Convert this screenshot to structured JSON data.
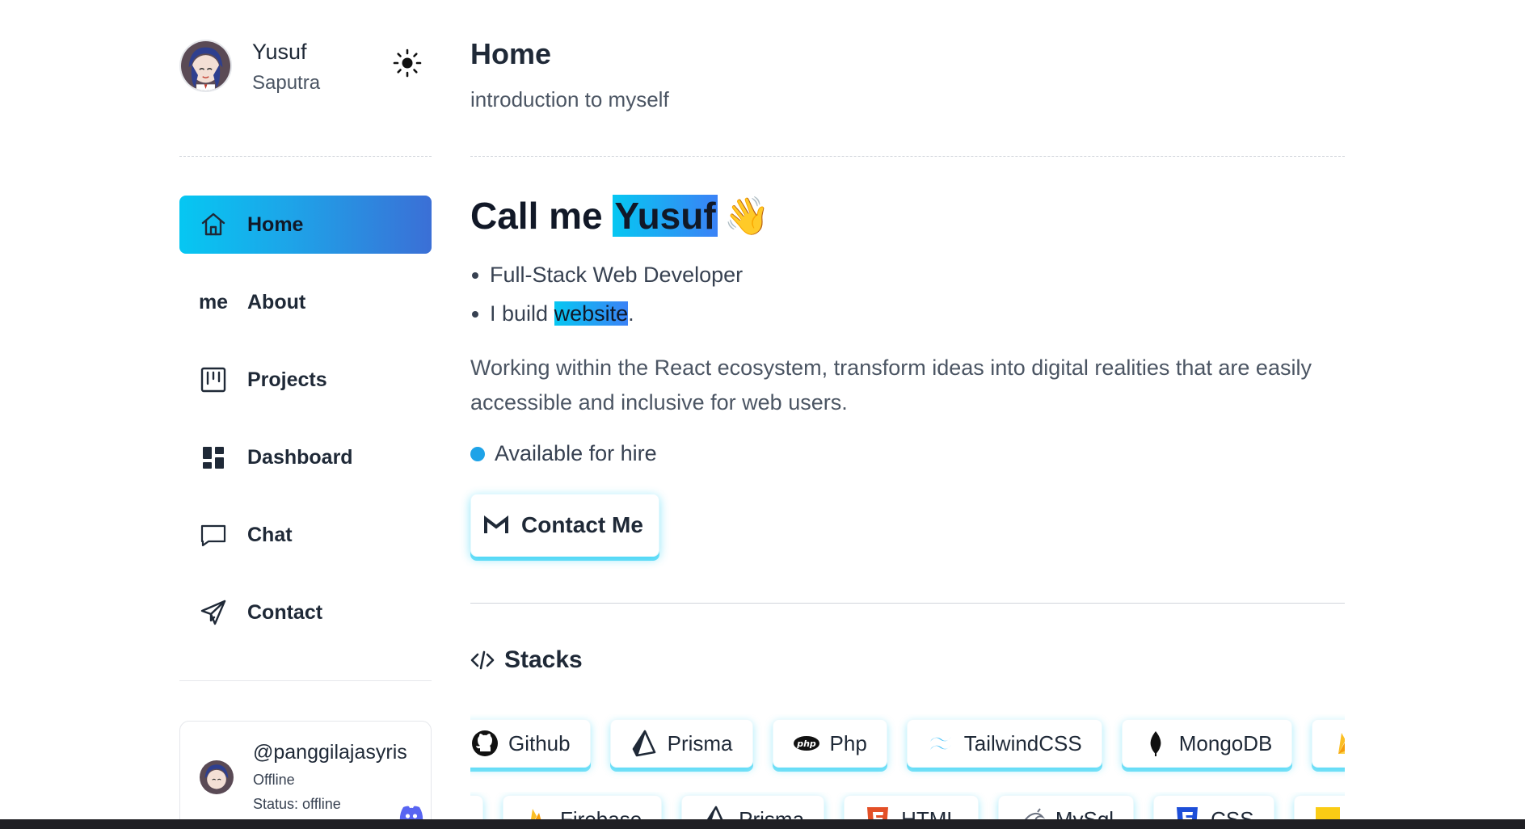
{
  "profile": {
    "first_name": "Yusuf",
    "last_name": "Saputra"
  },
  "header": {
    "title": "Home",
    "subtitle": "introduction to myself"
  },
  "sidebar": {
    "items": [
      {
        "label": "Home",
        "icon": "home-icon",
        "active": true
      },
      {
        "label": "About",
        "icon": "me-text-icon",
        "icon_text": "me",
        "active": false
      },
      {
        "label": "Projects",
        "icon": "projects-board-icon",
        "active": false
      },
      {
        "label": "Dashboard",
        "icon": "dashboard-grid-icon",
        "active": false
      },
      {
        "label": "Chat",
        "icon": "chat-bubble-icon",
        "active": false
      },
      {
        "label": "Contact",
        "icon": "paper-plane-icon",
        "active": false
      }
    ]
  },
  "discord": {
    "username": "@panggilajasyris",
    "state": "Offline",
    "status": "Status: offline"
  },
  "hero": {
    "prefix": "Call me",
    "name": "Yusuf",
    "emoji": "👋",
    "bullet_1": "Full-Stack Web Developer",
    "bullet_2_prefix": "I build",
    "bullet_2_highlight": "website",
    "bullet_2_suffix": ".",
    "description": "Working within the React ecosystem, transform ideas into digital realities that are easily accessible and inclusive for web users.",
    "availability": "Available for hire"
  },
  "contact_button": {
    "label": "Contact Me",
    "icon": "gmail-icon"
  },
  "stacks": {
    "heading": "Stacks",
    "row1": [
      {
        "label": "Github",
        "icon": "github-icon"
      },
      {
        "label": "Prisma",
        "icon": "prisma-icon"
      },
      {
        "label": "Php",
        "icon": "php-icon"
      },
      {
        "label": "TailwindCSS",
        "icon": "tailwind-icon"
      },
      {
        "label": "MongoDB",
        "icon": "mongodb-icon"
      },
      {
        "label": "",
        "icon": "firebase-icon"
      }
    ],
    "row2": [
      {
        "label": "",
        "icon": "tag-icon"
      },
      {
        "label": "Firebase",
        "icon": "firebase-icon"
      },
      {
        "label": "Prisma",
        "icon": "prisma-icon"
      },
      {
        "label": "HTML",
        "icon": "html5-icon"
      },
      {
        "label": "MySql",
        "icon": "mysql-icon"
      },
      {
        "label": "CSS",
        "icon": "css3-icon"
      },
      {
        "label": "",
        "icon": "javascript-icon"
      }
    ]
  },
  "colors": {
    "accent_start": "#06c7f2",
    "accent_end": "#3b6fd6",
    "availability_dot": "#1ea3e8"
  }
}
